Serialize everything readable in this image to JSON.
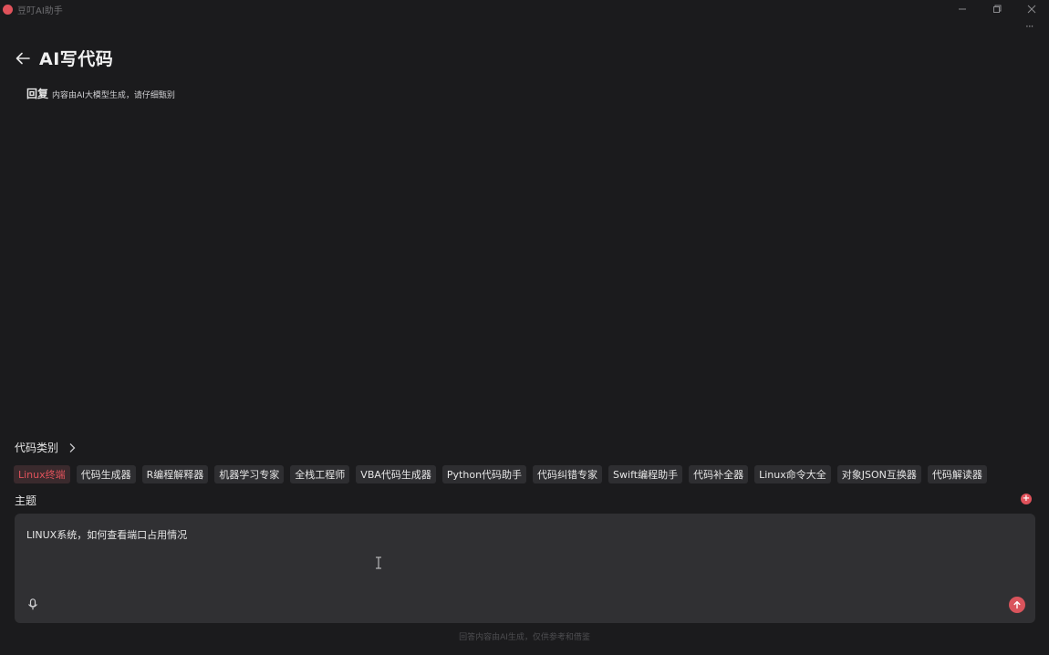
{
  "app": {
    "title": "豆叮AI助手"
  },
  "header": {
    "title": "AI写代码"
  },
  "reply": {
    "label": "回复",
    "note": "内容由AI大模型生成，请仔细甄别"
  },
  "category": {
    "title": "代码类别",
    "chips": [
      "Linux终端",
      "代码生成器",
      "R编程解释器",
      "机器学习专家",
      "全栈工程师",
      "VBA代码生成器",
      "Python代码助手",
      "代码纠错专家",
      "Swift编程助手",
      "代码补全器",
      "Linux命令大全",
      "对象JSON互换器",
      "代码解读器"
    ],
    "active_chip": "Linux终端"
  },
  "topic": {
    "label": "主题"
  },
  "input": {
    "value": "LINUX系统，如何查看端口占用情况"
  },
  "footer": {
    "note": "回答内容由AI生成，仅供参考和借鉴"
  },
  "colors": {
    "accent": "#e0525b",
    "background": "#1b1b1d",
    "input_bg": "#303033",
    "chip_bg": "#2e2e31"
  }
}
